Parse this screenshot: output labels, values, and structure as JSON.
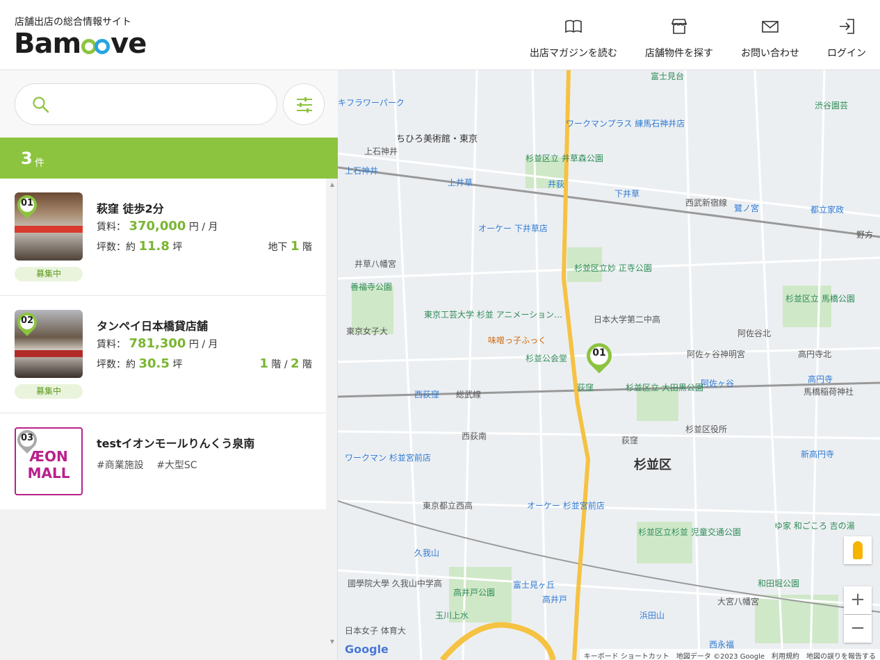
{
  "header": {
    "tagline": "店舗出店の総合情報サイト",
    "logo_prefix": "Bam",
    "logo_suffix": "ve",
    "nav": [
      {
        "label": "出店マガジンを読む",
        "icon": "book-icon"
      },
      {
        "label": "店舗物件を探す",
        "icon": "store-icon"
      },
      {
        "label": "お問い合わせ",
        "icon": "mail-icon"
      },
      {
        "label": "ログイン",
        "icon": "login-icon"
      }
    ]
  },
  "search": {
    "placeholder": ""
  },
  "results": {
    "count": "3",
    "unit": "件"
  },
  "listings": [
    {
      "number": "01",
      "title": "萩窪 徒歩2分",
      "rent_label": "賃料：",
      "rent": "370,000",
      "rent_unit": "円 / 月",
      "area_label": "坪数：約",
      "area": "11.8",
      "area_unit": "坪",
      "floor_prefix": "地下",
      "floor": "1",
      "floor_unit": "階",
      "status": "募集中"
    },
    {
      "number": "02",
      "title": "タンペイ日本橋貸店舗",
      "rent_label": "賃料：",
      "rent": "781,300",
      "rent_unit": "円 / 月",
      "area_label": "坪数：約",
      "area": "30.5",
      "area_unit": "坪",
      "floor_from": "1",
      "floor_sep": "階 /",
      "floor_to": "2",
      "floor_unit": "階",
      "status": "募集中"
    },
    {
      "number": "03",
      "title": "testイオンモールりんくう泉南",
      "logo_line1": "ÆON",
      "logo_line2": "MALL",
      "tags": [
        "#商業施設",
        "#大型SC"
      ]
    }
  ],
  "map": {
    "labels": [
      "富士見台",
      "キフラワーパーク",
      "ちひろ美術館・東京",
      "上石神井",
      "上石神井",
      "ワークマンプラス 練馬石神井店",
      "杉並区立 井草森公園",
      "上井草",
      "井荻",
      "下井草",
      "西武新宿線",
      "鷺ノ宮",
      "都立家政",
      "オーケー 下井草店",
      "井草八幡宮",
      "杉並区立妙 正寺公園",
      "善福寺公園",
      "東京工芸大学 杉並 アニメーション…",
      "日本大学第二中高",
      "阿佐谷北",
      "東京女子大",
      "味噌っ子ふっく",
      "阿佐ヶ谷神明宮",
      "高円寺北",
      "杉並公会堂",
      "荻窪",
      "杉並区立 大田黒公園",
      "西荻窪",
      "総武線",
      "阿佐ヶ谷",
      "高円寺",
      "馬橋稲荷神社",
      "杉並区役所",
      "西荻南",
      "荻窪",
      "杉並区",
      "ワークマン 杉並宮前店",
      "新高円寺",
      "東京都立西高",
      "オーケー 杉並宮前店",
      "杉並区立杉並 児童交通公園",
      "ゆ家 和ごころ 吉の湯",
      "久我山",
      "國學院大學 久我山中学高",
      "富士見ヶ丘",
      "高井戸公園",
      "高井戸",
      "和田堀公園",
      "大宮八幡宮",
      "玉川上水",
      "浜田山",
      "西永福",
      "日本女子 体育大",
      "杉並区立 馬橋公園",
      "渋谷園芸",
      "野方"
    ],
    "pin": "01",
    "attribution": "キーボード ショートカット　地図データ ©2023 Google　利用規約　地図の誤りを報告する",
    "google": "Google",
    "zoom_in": "+",
    "zoom_out": "−"
  }
}
